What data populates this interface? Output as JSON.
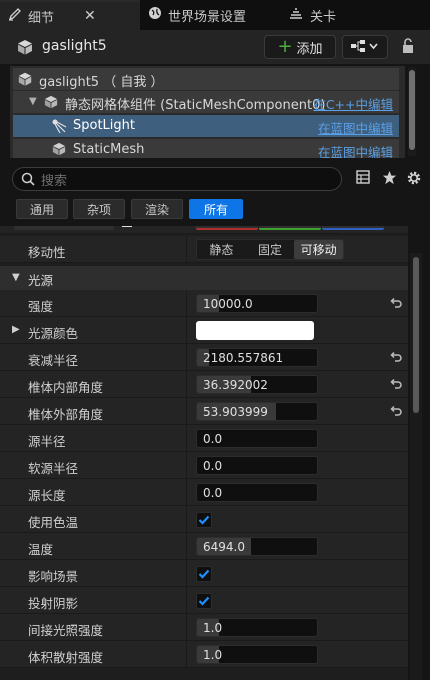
{
  "tabs": [
    {
      "label": "细节",
      "icon": "pencil-icon",
      "active": true,
      "close": "✕"
    },
    {
      "label": "世界场景设置",
      "icon": "globe-icon",
      "active": false
    },
    {
      "label": "关卡",
      "icon": "levels-icon",
      "active": false
    }
  ],
  "header": {
    "title": "gaslight5",
    "add_label": "添加"
  },
  "tree": [
    {
      "label": "gaslight5 （ 自我 ）",
      "link": ""
    },
    {
      "label": "静态网格体组件 (StaticMeshComponent0)",
      "link": "在C++中编辑"
    },
    {
      "label": "SpotLight",
      "link": "在蓝图中编辑",
      "selected": true
    },
    {
      "label": "StaticMesh",
      "link": "在蓝图中编辑"
    }
  ],
  "search": {
    "placeholder": "搜索"
  },
  "filters": [
    "通用",
    "杂项",
    "渲染",
    "所有"
  ],
  "active_filter": "所有",
  "mobility": {
    "label": "移动性",
    "options": [
      "静态",
      "固定",
      "可移动"
    ],
    "selected": "可移动"
  },
  "section": {
    "label": "光源"
  },
  "properties": [
    {
      "label": "强度",
      "kind": "number",
      "value": "10000.0",
      "fill": 0.18,
      "reset": true
    },
    {
      "label": "光源颜色",
      "kind": "color",
      "color": "#ffffff",
      "expandable": true
    },
    {
      "label": "衰减半径",
      "kind": "number",
      "value": "2180.557861",
      "fill": 0.1,
      "reset": true
    },
    {
      "label": "椎体内部角度",
      "kind": "number",
      "value": "36.392002",
      "fill": 0.45,
      "reset": true
    },
    {
      "label": "椎体外部角度",
      "kind": "number",
      "value": "53.903999",
      "fill": 0.66,
      "reset": true
    },
    {
      "label": "源半径",
      "kind": "number",
      "value": "0.0",
      "fill": 0
    },
    {
      "label": "软源半径",
      "kind": "number",
      "value": "0.0",
      "fill": 0
    },
    {
      "label": "源长度",
      "kind": "number",
      "value": "0.0",
      "fill": 0
    },
    {
      "label": "使用色温",
      "kind": "checkbox",
      "checked": true
    },
    {
      "label": "温度",
      "kind": "number",
      "value": "6494.0",
      "fill": 0.45
    },
    {
      "label": "影响场景",
      "kind": "checkbox",
      "checked": true
    },
    {
      "label": "投射阴影",
      "kind": "checkbox",
      "checked": true
    },
    {
      "label": "间接光照强度",
      "kind": "number",
      "value": "1.0",
      "fill": 0.18
    },
    {
      "label": "体积散射强度",
      "kind": "number",
      "value": "1.0",
      "fill": 0.18
    }
  ],
  "colors": {
    "accent": "#0e75e6",
    "link": "#5aa0e6",
    "check": "#1e8fff",
    "selection": "#3f5f7f",
    "add_plus": "#4caf3c"
  }
}
